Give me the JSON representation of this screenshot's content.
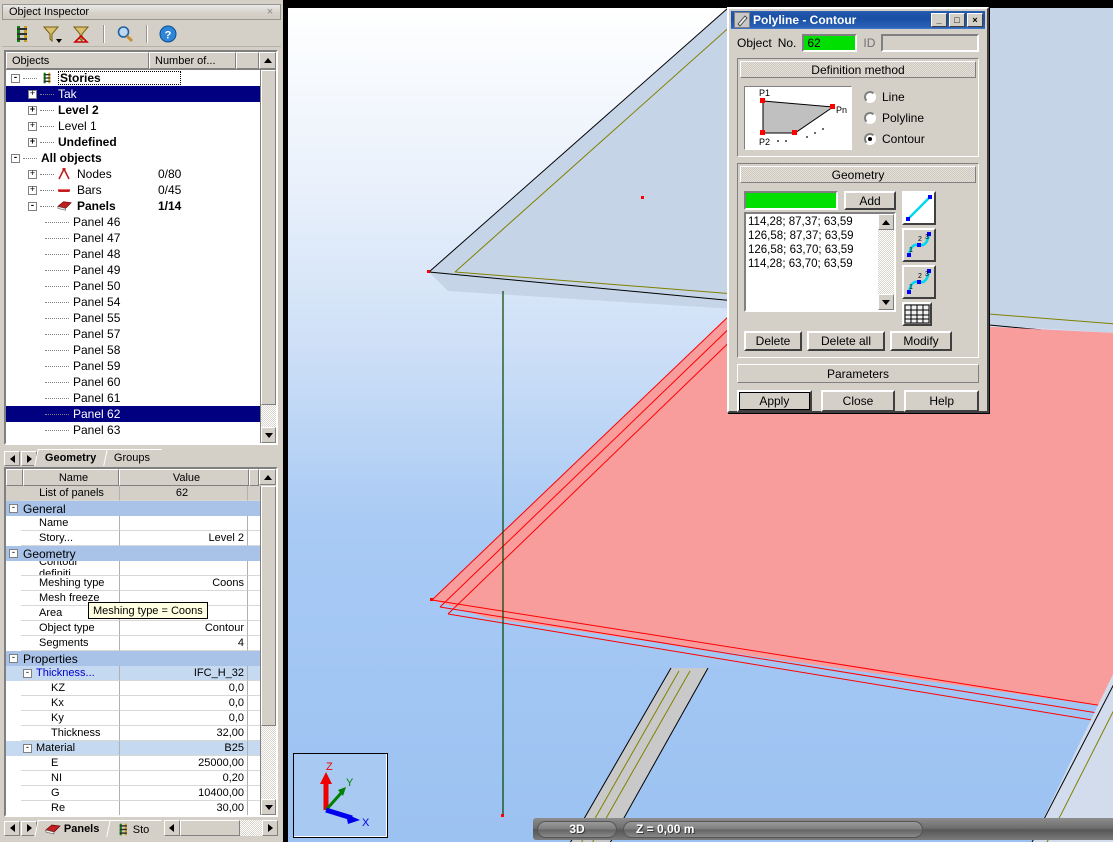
{
  "inspector": {
    "title": "Object Inspector",
    "close_label": "×",
    "toolbar": [
      {
        "name": "stories-icon",
        "label": ""
      },
      {
        "name": "filter-icon",
        "label": ""
      },
      {
        "name": "filter-clear-icon",
        "label": ""
      },
      {
        "name": "search-icon",
        "label": ""
      },
      {
        "name": "help-icon",
        "label": ""
      }
    ],
    "tree_columns": [
      "Objects",
      "Number of..."
    ],
    "tree": [
      {
        "label": "Stories",
        "num": "",
        "depth": 0,
        "exp": "-",
        "bold": true,
        "sel": false,
        "icon": "stories-icon",
        "dotted": true
      },
      {
        "label": "Tak",
        "num": "",
        "depth": 1,
        "exp": "+",
        "bold": false,
        "sel": true,
        "icon": "",
        "dotted": false
      },
      {
        "label": "Level 2",
        "num": "",
        "depth": 1,
        "exp": "+",
        "bold": true,
        "sel": false,
        "icon": "",
        "dotted": false
      },
      {
        "label": "Level 1",
        "num": "",
        "depth": 1,
        "exp": "+",
        "bold": false,
        "sel": false,
        "icon": "",
        "dotted": false
      },
      {
        "label": "Undefined",
        "num": "",
        "depth": 1,
        "exp": "+",
        "bold": true,
        "sel": false,
        "icon": "",
        "dotted": false
      },
      {
        "label": "All objects",
        "num": "",
        "depth": 0,
        "exp": "-",
        "bold": true,
        "sel": false,
        "icon": "",
        "dotted": false
      },
      {
        "label": "Nodes",
        "num": "0/80",
        "depth": 1,
        "exp": "+",
        "bold": false,
        "sel": false,
        "icon": "node-icon",
        "dotted": false
      },
      {
        "label": "Bars",
        "num": "0/45",
        "depth": 1,
        "exp": "+",
        "bold": false,
        "sel": false,
        "icon": "bar-icon",
        "dotted": false
      },
      {
        "label": "Panels",
        "num": "1/14",
        "depth": 1,
        "exp": "-",
        "bold": true,
        "sel": false,
        "icon": "panel-icon",
        "dotted": false
      },
      {
        "label": "Panel    46",
        "num": "",
        "depth": 2,
        "exp": "",
        "bold": false,
        "sel": false,
        "icon": "",
        "dotted": false
      },
      {
        "label": "Panel    47",
        "num": "",
        "depth": 2,
        "exp": "",
        "bold": false,
        "sel": false,
        "icon": "",
        "dotted": false
      },
      {
        "label": "Panel    48",
        "num": "",
        "depth": 2,
        "exp": "",
        "bold": false,
        "sel": false,
        "icon": "",
        "dotted": false
      },
      {
        "label": "Panel    49",
        "num": "",
        "depth": 2,
        "exp": "",
        "bold": false,
        "sel": false,
        "icon": "",
        "dotted": false
      },
      {
        "label": "Panel    50",
        "num": "",
        "depth": 2,
        "exp": "",
        "bold": false,
        "sel": false,
        "icon": "",
        "dotted": false
      },
      {
        "label": "Panel    54",
        "num": "",
        "depth": 2,
        "exp": "",
        "bold": false,
        "sel": false,
        "icon": "",
        "dotted": false
      },
      {
        "label": "Panel    55",
        "num": "",
        "depth": 2,
        "exp": "",
        "bold": false,
        "sel": false,
        "icon": "",
        "dotted": false
      },
      {
        "label": "Panel    57",
        "num": "",
        "depth": 2,
        "exp": "",
        "bold": false,
        "sel": false,
        "icon": "",
        "dotted": false
      },
      {
        "label": "Panel    58",
        "num": "",
        "depth": 2,
        "exp": "",
        "bold": false,
        "sel": false,
        "icon": "",
        "dotted": false
      },
      {
        "label": "Panel    59",
        "num": "",
        "depth": 2,
        "exp": "",
        "bold": false,
        "sel": false,
        "icon": "",
        "dotted": false
      },
      {
        "label": "Panel    60",
        "num": "",
        "depth": 2,
        "exp": "",
        "bold": false,
        "sel": false,
        "icon": "",
        "dotted": false
      },
      {
        "label": "Panel    61",
        "num": "",
        "depth": 2,
        "exp": "",
        "bold": false,
        "sel": false,
        "icon": "",
        "dotted": false
      },
      {
        "label": "Panel    62",
        "num": "",
        "depth": 2,
        "exp": "",
        "bold": false,
        "sel": true,
        "icon": "",
        "dotted": false
      },
      {
        "label": "Panel    63",
        "num": "",
        "depth": 2,
        "exp": "",
        "bold": false,
        "sel": false,
        "icon": "",
        "dotted": false
      }
    ],
    "tabs_top": [
      {
        "label": "Geometry",
        "active": true
      },
      {
        "label": "Groups",
        "active": false
      }
    ],
    "prop_columns": [
      "Name",
      "Value"
    ],
    "properties": [
      {
        "kind": "gray",
        "name": "List of panels",
        "value": "62"
      },
      {
        "kind": "section",
        "name": "General",
        "value": "",
        "exp": "-"
      },
      {
        "kind": "item",
        "name": "Name",
        "value": ""
      },
      {
        "kind": "item",
        "name": "Story...",
        "value": "Level 2",
        "blue": true
      },
      {
        "kind": "section",
        "name": "Geometry",
        "value": "",
        "exp": "-"
      },
      {
        "kind": "item",
        "name": "Contour definiti...",
        "value": "",
        "blue": true
      },
      {
        "kind": "item",
        "name": "Meshing type",
        "value": "Coons"
      },
      {
        "kind": "item",
        "name": "Mesh freeze",
        "value": ""
      },
      {
        "kind": "item",
        "name": "Area",
        "value": ""
      },
      {
        "kind": "item",
        "name": "Object type",
        "value": "Contour"
      },
      {
        "kind": "item",
        "name": "Segments",
        "value": "4"
      },
      {
        "kind": "section",
        "name": "Properties",
        "value": "",
        "exp": "-"
      },
      {
        "kind": "sub",
        "name": "Thickness...",
        "value": "IFC_H_32",
        "exp": "-",
        "blue": true
      },
      {
        "kind": "item2",
        "name": "KZ",
        "value": "0,0"
      },
      {
        "kind": "item2",
        "name": "Kx",
        "value": "0,0"
      },
      {
        "kind": "item2",
        "name": "Ky",
        "value": "0,0"
      },
      {
        "kind": "item2",
        "name": "Thickness",
        "value": "32,00"
      },
      {
        "kind": "sub",
        "name": "Material",
        "value": "B25",
        "exp": "-"
      },
      {
        "kind": "item2",
        "name": "E",
        "value": "25000,00"
      },
      {
        "kind": "item2",
        "name": "NI",
        "value": "0,20"
      },
      {
        "kind": "item2",
        "name": "G",
        "value": "10400,00"
      },
      {
        "kind": "item2",
        "name": "Re",
        "value": "30,00"
      }
    ],
    "tooltip": "Meshing type = Coons",
    "tabs_bottom": [
      {
        "label": "Panels",
        "active": true,
        "icon": "panel-icon"
      },
      {
        "label": "Sto",
        "active": false,
        "icon": "stories-icon"
      }
    ]
  },
  "dialog": {
    "title": "Polyline - Contour",
    "icon": "polyline-icon",
    "minimize_label": "_",
    "maximize_label": "□",
    "close_label": "×",
    "object_label": "Object",
    "no_label": "No.",
    "no_value": "62",
    "id_label": "ID",
    "id_value": "",
    "definition_method": {
      "title": "Definition method",
      "preview_labels": [
        "P1",
        "Pn",
        "P2"
      ],
      "options": [
        {
          "label": "Line",
          "selected": false
        },
        {
          "label": "Polyline",
          "selected": false
        },
        {
          "label": "Contour",
          "selected": true
        }
      ]
    },
    "geometry": {
      "title": "Geometry",
      "input_value": "",
      "add_label": "Add",
      "coordinates": [
        "114,28; 87,37; 63,59",
        "126,58; 87,37; 63,59",
        "126,58; 63,70; 63,59",
        "114,28; 63,70; 63,59"
      ],
      "side_icons": [
        "line-tool-icon",
        "polyline-tool-icon",
        "spline-tool-icon",
        "table-tool-icon"
      ],
      "buttons": [
        {
          "label": "Delete",
          "name": "delete-button"
        },
        {
          "label": "Delete all",
          "name": "delete-all-button"
        },
        {
          "label": "Modify",
          "name": "modify-button"
        }
      ]
    },
    "parameters_label": "Parameters",
    "footer": [
      {
        "label": "Apply",
        "name": "apply-button",
        "default": true
      },
      {
        "label": "Close",
        "name": "close-button",
        "default": false
      },
      {
        "label": "Help",
        "name": "help-button",
        "default": false
      }
    ]
  },
  "viewport": {
    "status": {
      "view_mode": "3D",
      "z_level": "Z = 0,00 m"
    },
    "axis": {
      "x_label": "X",
      "y_label": "Y",
      "z_label": "Z",
      "x_color": "#0000ee",
      "y_color": "#008000",
      "z_color": "#ee0000"
    },
    "colors": {
      "background_top": "#ffffff",
      "background_bottom": "#9cc2f2",
      "selected_panel": "#f99c9c",
      "selected_panel_edge": "#ff0000",
      "panel_face": "#c6d4e8",
      "panel_edge": "#000000",
      "panel_local_axis": "#808000",
      "bar_line": "#004400",
      "node_marker": "#ff0000"
    }
  }
}
